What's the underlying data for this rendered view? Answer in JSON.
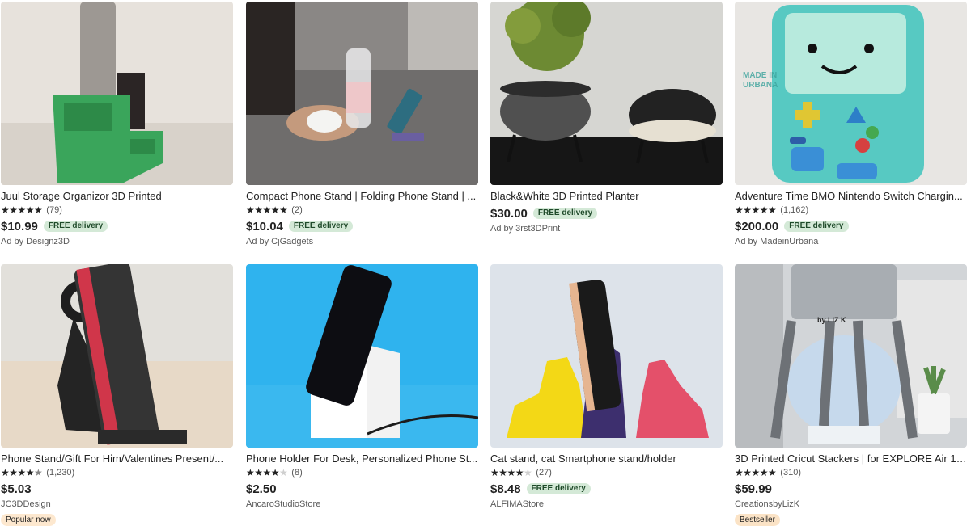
{
  "listings": [
    {
      "title": "Juul Storage Organizor 3D Printed",
      "rating": 5,
      "reviews": "(79)",
      "price": "$10.99",
      "free_delivery": "FREE delivery",
      "seller": "Ad by Designz3D",
      "badge": ""
    },
    {
      "title": "Compact Phone Stand | Folding Phone Stand | ...",
      "rating": 5,
      "reviews": "(2)",
      "price": "$10.04",
      "free_delivery": "FREE delivery",
      "seller": "Ad by CjGadgets",
      "badge": ""
    },
    {
      "title": "Black&White 3D Printed Planter",
      "rating": 0,
      "reviews": "",
      "price": "$30.00",
      "free_delivery": "FREE delivery",
      "seller": "Ad by 3rst3DPrint",
      "badge": ""
    },
    {
      "title": "Adventure Time BMO Nintendo Switch Chargin...",
      "rating": 5,
      "reviews": "(1,162)",
      "price": "$200.00",
      "free_delivery": "FREE delivery",
      "seller": "Ad by MadeinUrbana",
      "badge": "",
      "image_text": "MADE IN URBANA"
    },
    {
      "title": "Phone Stand/Gift For Him/Valentines Present/...",
      "rating": 4.5,
      "reviews": "(1,230)",
      "price": "$5.03",
      "free_delivery": "",
      "seller": "JC3DDesign",
      "badge": "Popular now"
    },
    {
      "title": "Phone Holder For Desk, Personalized Phone St...",
      "rating": 4,
      "reviews": "(8)",
      "price": "$2.50",
      "free_delivery": "",
      "seller": "AncaroStudioStore",
      "badge": ""
    },
    {
      "title": "Cat stand, cat Smartphone stand/holder",
      "rating": 4,
      "reviews": "(27)",
      "price": "$8.48",
      "free_delivery": "FREE delivery",
      "seller": "ALFIMAStore",
      "badge": ""
    },
    {
      "title": "3D Printed Cricut Stackers | for EXPLORE Air 1,...",
      "rating": 5,
      "reviews": "(310)",
      "price": "$59.99",
      "free_delivery": "",
      "seller": "CreationsbyLizK",
      "badge": "Bestseller",
      "image_text": "by LIZ K"
    }
  ],
  "colors": {
    "free_delivery_bg": "#d4e9d7",
    "popular_bg": "#fde8cf",
    "bestseller_bg": "#fbe3c6"
  }
}
